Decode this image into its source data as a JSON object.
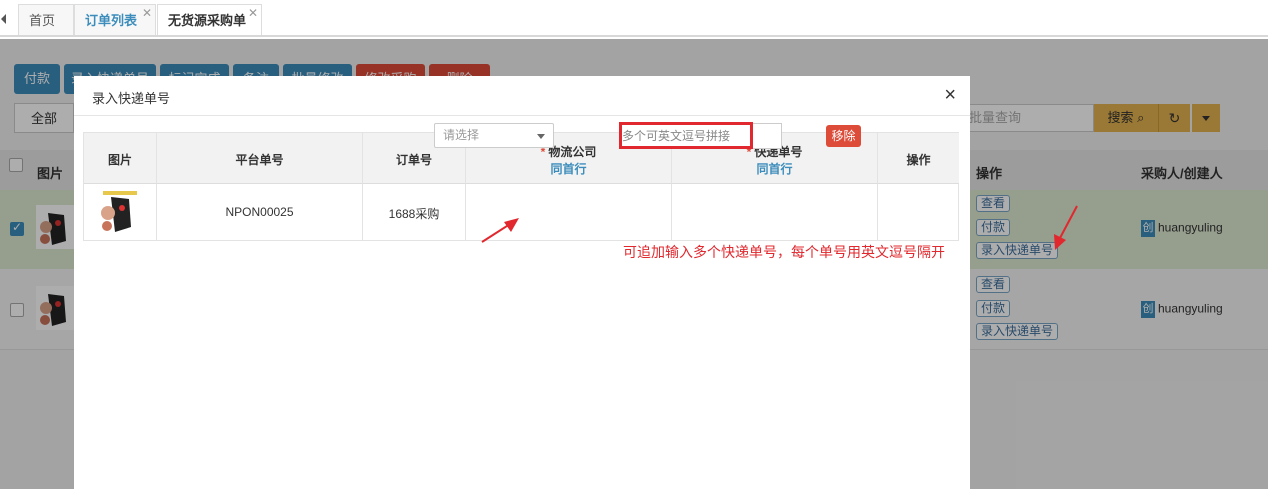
{
  "tabs": [
    {
      "label": "首页",
      "closable": false
    },
    {
      "label": "订单列表",
      "closable": true
    },
    {
      "label": "无货源采购单",
      "closable": true
    }
  ],
  "toolbar": {
    "pay_label": "付款",
    "buttons": [
      "录入快递单号",
      "标记完成",
      "备注",
      "批量修改",
      "修改采购",
      "删除"
    ],
    "filter_all": "全部",
    "search_placeholder": "批量查询",
    "search_label": "搜索"
  },
  "table": {
    "headers": {
      "image": "图片",
      "operation": "操作",
      "creator": "采购人/创建人"
    },
    "rows": [
      {
        "checked": true,
        "ops": [
          "查看",
          "付款",
          "录入快递单号"
        ],
        "creator": "huangyuling",
        "creator_badge": "创"
      },
      {
        "checked": false,
        "ops": [
          "查看",
          "付款",
          "录入快递单号"
        ],
        "creator": "huangyuling",
        "creator_badge": "创"
      }
    ]
  },
  "modal": {
    "title": "录入快递单号",
    "close": "×",
    "columns": {
      "image": "图片",
      "platform_no": "平台单号",
      "order_no": "订单号",
      "logistics": "物流公司",
      "logistics_same": "同首行",
      "tracking": "快递单号",
      "tracking_same": "同首行",
      "operation": "操作"
    },
    "row": {
      "platform_no": "NPON00025",
      "order_no": "1688采购",
      "select_placeholder": "请选择",
      "tracking_placeholder": "多个可英文逗号拼接",
      "remove_label": "移除"
    },
    "note": "可追加输入多个快递单号，每个单号用英文逗号隔开"
  },
  "colors": {
    "primary": "#3c8dbc",
    "danger": "#dd4b39",
    "warning": "#e3b24e",
    "annotation": "#e0282e"
  }
}
